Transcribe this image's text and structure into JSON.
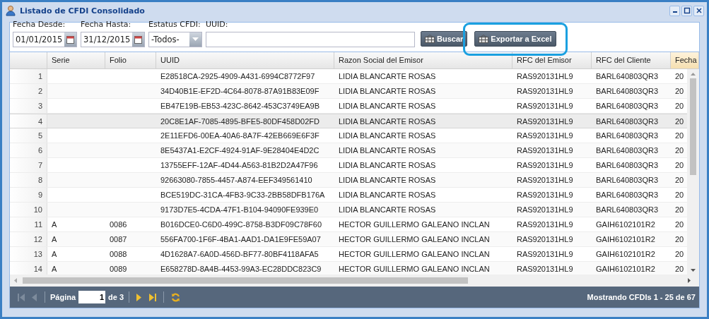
{
  "window": {
    "title": "Listado de CFDI Consolidado"
  },
  "filters": [
    {
      "kind": "date",
      "label": "Fecha Desde:",
      "value": "01/01/2015"
    },
    {
      "kind": "date",
      "label": "Fecha Hasta:",
      "value": "31/12/2015"
    },
    {
      "kind": "select",
      "label": "Estatus CFDI:",
      "value": "-Todos-"
    },
    {
      "kind": "text",
      "label": "UUID:"
    }
  ],
  "buttons": [
    {
      "label": "Buscar",
      "highlighted": false
    },
    {
      "label": "Exportar a Excel",
      "highlighted": true
    }
  ],
  "table": {
    "columns": [
      {
        "label": "Serie",
        "sorted": false
      },
      {
        "label": "Folio",
        "sorted": false
      },
      {
        "label": "UUID",
        "sorted": false
      },
      {
        "label": "Razon Social del Emisor",
        "sorted": false
      },
      {
        "label": "RFC del Emisor",
        "sorted": false
      },
      {
        "label": "RFC del Cliente",
        "sorted": false
      },
      {
        "label": "Fecha",
        "sorted": true
      }
    ],
    "rows": [
      {
        "number": "1",
        "selected": false,
        "cells": [
          "",
          "",
          "E28518CA-2925-4909-A431-6994C8772F97",
          "LIDIA BLANCARTE ROSAS",
          "RAS920131HL9",
          "BARL640803QR3",
          "20"
        ]
      },
      {
        "number": "2",
        "selected": false,
        "cells": [
          "",
          "",
          "34D40B1E-EF2D-4C64-8078-87A91B83E09F",
          "LIDIA BLANCARTE ROSAS",
          "RAS920131HL9",
          "BARL640803QR3",
          "20"
        ]
      },
      {
        "number": "3",
        "selected": false,
        "cells": [
          "",
          "",
          "EB47E19B-EB53-423C-8642-453C3749EA9B",
          "LIDIA BLANCARTE ROSAS",
          "RAS920131HL9",
          "BARL640803QR3",
          "20"
        ]
      },
      {
        "number": "4",
        "selected": true,
        "cells": [
          "",
          "",
          "20C8E1AF-7085-4895-BFE5-80DF458D02FD",
          "LIDIA BLANCARTE ROSAS",
          "RAS920131HL9",
          "BARL640803QR3",
          "20"
        ]
      },
      {
        "number": "5",
        "selected": false,
        "cells": [
          "",
          "",
          "2E11EFD6-00EA-40A6-8A7F-42EB669E6F3F",
          "LIDIA BLANCARTE ROSAS",
          "RAS920131HL9",
          "BARL640803QR3",
          "20"
        ]
      },
      {
        "number": "6",
        "selected": false,
        "cells": [
          "",
          "",
          "8E5437A1-E2CF-4924-91AF-9E28404E4D2C",
          "LIDIA BLANCARTE ROSAS",
          "RAS920131HL9",
          "BARL640803QR3",
          "20"
        ]
      },
      {
        "number": "7",
        "selected": false,
        "cells": [
          "",
          "",
          "13755EFF-12AF-4D44-A563-81B2D2A47F96",
          "LIDIA BLANCARTE ROSAS",
          "RAS920131HL9",
          "BARL640803QR3",
          "20"
        ]
      },
      {
        "number": "8",
        "selected": false,
        "cells": [
          "",
          "",
          "92663080-7855-4457-A874-EEF349561410",
          "LIDIA BLANCARTE ROSAS",
          "RAS920131HL9",
          "BARL640803QR3",
          "20"
        ]
      },
      {
        "number": "9",
        "selected": false,
        "cells": [
          "",
          "",
          "BCE519DC-31CA-4FB3-9C33-2BB58DFB176A",
          "LIDIA BLANCARTE ROSAS",
          "RAS920131HL9",
          "BARL640803QR3",
          "20"
        ]
      },
      {
        "number": "10",
        "selected": false,
        "cells": [
          "",
          "",
          "9173D7E5-4CDA-47F1-B104-94090FE939E0",
          "LIDIA BLANCARTE ROSAS",
          "RAS920131HL9",
          "BARL640803QR3",
          "20"
        ]
      },
      {
        "number": "11",
        "selected": false,
        "cells": [
          "A",
          "0086",
          "B016DCE0-C6D0-499C-8758-B3DF09C78F60",
          "HECTOR GUILLERMO GALEANO INCLAN",
          "RAS920131HL9",
          "GAIH6102101R2",
          "20"
        ]
      },
      {
        "number": "12",
        "selected": false,
        "cells": [
          "A",
          "0087",
          "556FA700-1F6F-4BA1-AAD1-DA1E9FE59A07",
          "HECTOR GUILLERMO GALEANO INCLAN",
          "RAS920131HL9",
          "GAIH6102101R2",
          "20"
        ]
      },
      {
        "number": "13",
        "selected": false,
        "cells": [
          "A",
          "0088",
          "4D1628A7-6A0D-456D-BF77-80BF4118AFA5",
          "HECTOR GUILLERMO GALEANO INCLAN",
          "RAS920131HL9",
          "GAIH6102101R2",
          "20"
        ]
      },
      {
        "number": "14",
        "selected": false,
        "cells": [
          "A",
          "0089",
          "E658278D-8A4B-4453-99A3-EC28DDC823C9",
          "HECTOR GUILLERMO GALEANO INCLAN",
          "RAS920131HL9",
          "GAIH6102101R2",
          "20"
        ]
      }
    ]
  },
  "pager": {
    "page_label": "Página",
    "page": "1",
    "of": "de 3",
    "first_disabled": true,
    "prev_disabled": true,
    "status": "Mostrando CFDIs 1 - 25 de 67"
  }
}
